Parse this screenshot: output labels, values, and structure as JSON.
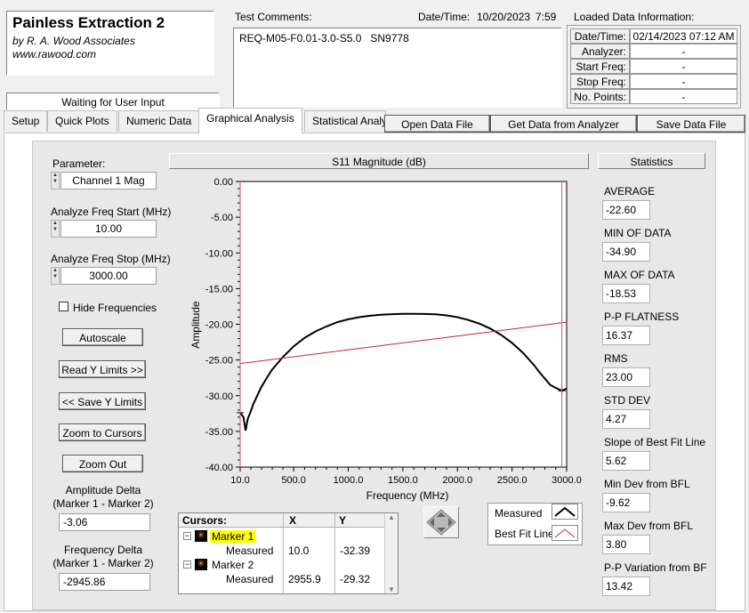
{
  "app": {
    "title": "Painless Extraction 2",
    "company": "by R. A. Wood Associates",
    "website": "www.rawood.com",
    "status": "Waiting for User Input"
  },
  "comments": {
    "label": "Test Comments:",
    "datetime_label": "Date/Time:",
    "date": "10/20/2023",
    "time": "7:59",
    "text": "REQ-M05-F0.01-3.0-S5.0   SN9778"
  },
  "loaded_info": {
    "title": "Loaded Data Information:",
    "rows": [
      {
        "key": "Date/Time:",
        "value": "02/14/2023 07:12 AM"
      },
      {
        "key": "Analyzer:",
        "value": "-"
      },
      {
        "key": "Start Freq:",
        "value": "-"
      },
      {
        "key": "Stop Freq:",
        "value": "-"
      },
      {
        "key": "No. Points:",
        "value": "-"
      }
    ]
  },
  "tabs": [
    "Setup",
    "Quick Plots",
    "Numeric Data",
    "Graphical Analysis",
    "Statistical Analy"
  ],
  "active_tab": "Graphical Analysis",
  "file_buttons": {
    "open": "Open Data File",
    "get": "Get Data from Analyzer",
    "save": "Save Data File"
  },
  "left": {
    "parameter_label": "Parameter:",
    "parameter_value": "Channel 1 Mag",
    "start_label": "Analyze Freq Start (MHz)",
    "start_value": "10.00",
    "stop_label": "Analyze Freq Stop (MHz)",
    "stop_value": "3000.00",
    "hide_freq_label": "Hide Frequencies",
    "autoscale": "Autoscale",
    "read_y": "Read Y Limits >>",
    "save_y": "<< Save Y Limits",
    "zoom_cursors": "Zoom to Cursors",
    "zoom_out": "Zoom Out",
    "amp_delta_label1": "Amplitude Delta",
    "amp_delta_label2": "(Marker 1 - Marker 2)",
    "amp_delta_value": "-3.06",
    "freq_delta_label1": "Frequency Delta",
    "freq_delta_label2": "(Marker 1 - Marker 2)",
    "freq_delta_value": "-2945.86"
  },
  "cursors": {
    "header": [
      "Cursors:",
      "X",
      "Y"
    ],
    "rows": [
      {
        "name": "Marker 1",
        "sub": "Measured",
        "x": "10.0",
        "y": "-32.39"
      },
      {
        "name": "Marker 2",
        "sub": "Measured",
        "x": "2955.9",
        "y": "-29.32"
      }
    ]
  },
  "legend": {
    "measured": "Measured",
    "bestfit": "Best Fit Line"
  },
  "statistics": {
    "title": "Statistics",
    "items": [
      {
        "label": "AVERAGE",
        "value": "-22.60"
      },
      {
        "label": "MIN OF DATA",
        "value": "-34.90"
      },
      {
        "label": "MAX OF DATA",
        "value": "-18.53"
      },
      {
        "label": "P-P FLATNESS",
        "value": "16.37"
      },
      {
        "label": "RMS",
        "value": "23.00"
      },
      {
        "label": "STD DEV",
        "value": "4.27"
      },
      {
        "label": "Slope of Best Fit Line",
        "value": "5.62"
      },
      {
        "label": "Min Dev from BFL",
        "value": "-9.62"
      },
      {
        "label": "Max Dev from BFL",
        "value": "3.80"
      },
      {
        "label": "P-P Variation from BF",
        "value": "13.42"
      }
    ]
  },
  "colors": {
    "measured": "#000000",
    "bestfit": "#cc2233",
    "cursor": "#e05080",
    "marker_highlight": "#ffff00"
  },
  "chart_data": {
    "type": "line",
    "title": "S11 Magnitude (dB)",
    "xlabel": "Frequency (MHz)",
    "ylabel": "Amplitude",
    "xlim": [
      10,
      3000
    ],
    "ylim": [
      -40,
      0
    ],
    "xticks": [
      "10.0",
      "500.0",
      "1000.0",
      "1500.0",
      "2000.0",
      "2500.0",
      "3000.0"
    ],
    "yticks": [
      "0.00",
      "-5.00",
      "-10.00",
      "-15.00",
      "-20.00",
      "-25.00",
      "-30.00",
      "-35.00",
      "-40.00"
    ],
    "series": [
      {
        "name": "Measured",
        "x": [
          10,
          40,
          60,
          80,
          100,
          130,
          160,
          200,
          250,
          300,
          400,
          500,
          600,
          700,
          800,
          900,
          1000,
          1100,
          1200,
          1300,
          1400,
          1500,
          1600,
          1700,
          1800,
          1900,
          2000,
          2100,
          2200,
          2300,
          2400,
          2500,
          2600,
          2700,
          2750,
          2800,
          2850,
          2900,
          2955.9,
          3000
        ],
        "y": [
          -32.39,
          -33.0,
          -34.9,
          -33.2,
          -32.5,
          -31.2,
          -30.2,
          -28.9,
          -27.6,
          -26.4,
          -24.6,
          -23.1,
          -21.9,
          -21.0,
          -20.3,
          -19.7,
          -19.3,
          -19.0,
          -18.8,
          -18.65,
          -18.58,
          -18.53,
          -18.53,
          -18.55,
          -18.6,
          -18.75,
          -19.0,
          -19.4,
          -19.9,
          -20.6,
          -21.5,
          -22.6,
          -24.0,
          -25.7,
          -26.7,
          -27.6,
          -28.5,
          -28.9,
          -29.32,
          -29.0
        ]
      },
      {
        "name": "Best Fit Line",
        "x": [
          10,
          3000
        ],
        "y": [
          -25.5,
          -19.7
        ]
      }
    ],
    "cursors_x": [
      10.0,
      2955.9
    ]
  }
}
